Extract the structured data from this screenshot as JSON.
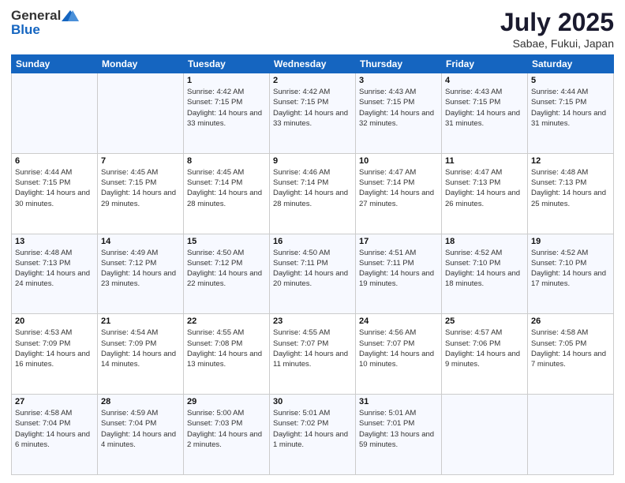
{
  "header": {
    "logo_general": "General",
    "logo_blue": "Blue",
    "month": "July 2025",
    "location": "Sabae, Fukui, Japan"
  },
  "weekdays": [
    "Sunday",
    "Monday",
    "Tuesday",
    "Wednesday",
    "Thursday",
    "Friday",
    "Saturday"
  ],
  "weeks": [
    [
      {
        "day": "",
        "sunrise": "",
        "sunset": "",
        "daylight": ""
      },
      {
        "day": "",
        "sunrise": "",
        "sunset": "",
        "daylight": ""
      },
      {
        "day": "1",
        "sunrise": "Sunrise: 4:42 AM",
        "sunset": "Sunset: 7:15 PM",
        "daylight": "Daylight: 14 hours and 33 minutes."
      },
      {
        "day": "2",
        "sunrise": "Sunrise: 4:42 AM",
        "sunset": "Sunset: 7:15 PM",
        "daylight": "Daylight: 14 hours and 33 minutes."
      },
      {
        "day": "3",
        "sunrise": "Sunrise: 4:43 AM",
        "sunset": "Sunset: 7:15 PM",
        "daylight": "Daylight: 14 hours and 32 minutes."
      },
      {
        "day": "4",
        "sunrise": "Sunrise: 4:43 AM",
        "sunset": "Sunset: 7:15 PM",
        "daylight": "Daylight: 14 hours and 31 minutes."
      },
      {
        "day": "5",
        "sunrise": "Sunrise: 4:44 AM",
        "sunset": "Sunset: 7:15 PM",
        "daylight": "Daylight: 14 hours and 31 minutes."
      }
    ],
    [
      {
        "day": "6",
        "sunrise": "Sunrise: 4:44 AM",
        "sunset": "Sunset: 7:15 PM",
        "daylight": "Daylight: 14 hours and 30 minutes."
      },
      {
        "day": "7",
        "sunrise": "Sunrise: 4:45 AM",
        "sunset": "Sunset: 7:15 PM",
        "daylight": "Daylight: 14 hours and 29 minutes."
      },
      {
        "day": "8",
        "sunrise": "Sunrise: 4:45 AM",
        "sunset": "Sunset: 7:14 PM",
        "daylight": "Daylight: 14 hours and 28 minutes."
      },
      {
        "day": "9",
        "sunrise": "Sunrise: 4:46 AM",
        "sunset": "Sunset: 7:14 PM",
        "daylight": "Daylight: 14 hours and 28 minutes."
      },
      {
        "day": "10",
        "sunrise": "Sunrise: 4:47 AM",
        "sunset": "Sunset: 7:14 PM",
        "daylight": "Daylight: 14 hours and 27 minutes."
      },
      {
        "day": "11",
        "sunrise": "Sunrise: 4:47 AM",
        "sunset": "Sunset: 7:13 PM",
        "daylight": "Daylight: 14 hours and 26 minutes."
      },
      {
        "day": "12",
        "sunrise": "Sunrise: 4:48 AM",
        "sunset": "Sunset: 7:13 PM",
        "daylight": "Daylight: 14 hours and 25 minutes."
      }
    ],
    [
      {
        "day": "13",
        "sunrise": "Sunrise: 4:48 AM",
        "sunset": "Sunset: 7:13 PM",
        "daylight": "Daylight: 14 hours and 24 minutes."
      },
      {
        "day": "14",
        "sunrise": "Sunrise: 4:49 AM",
        "sunset": "Sunset: 7:12 PM",
        "daylight": "Daylight: 14 hours and 23 minutes."
      },
      {
        "day": "15",
        "sunrise": "Sunrise: 4:50 AM",
        "sunset": "Sunset: 7:12 PM",
        "daylight": "Daylight: 14 hours and 22 minutes."
      },
      {
        "day": "16",
        "sunrise": "Sunrise: 4:50 AM",
        "sunset": "Sunset: 7:11 PM",
        "daylight": "Daylight: 14 hours and 20 minutes."
      },
      {
        "day": "17",
        "sunrise": "Sunrise: 4:51 AM",
        "sunset": "Sunset: 7:11 PM",
        "daylight": "Daylight: 14 hours and 19 minutes."
      },
      {
        "day": "18",
        "sunrise": "Sunrise: 4:52 AM",
        "sunset": "Sunset: 7:10 PM",
        "daylight": "Daylight: 14 hours and 18 minutes."
      },
      {
        "day": "19",
        "sunrise": "Sunrise: 4:52 AM",
        "sunset": "Sunset: 7:10 PM",
        "daylight": "Daylight: 14 hours and 17 minutes."
      }
    ],
    [
      {
        "day": "20",
        "sunrise": "Sunrise: 4:53 AM",
        "sunset": "Sunset: 7:09 PM",
        "daylight": "Daylight: 14 hours and 16 minutes."
      },
      {
        "day": "21",
        "sunrise": "Sunrise: 4:54 AM",
        "sunset": "Sunset: 7:09 PM",
        "daylight": "Daylight: 14 hours and 14 minutes."
      },
      {
        "day": "22",
        "sunrise": "Sunrise: 4:55 AM",
        "sunset": "Sunset: 7:08 PM",
        "daylight": "Daylight: 14 hours and 13 minutes."
      },
      {
        "day": "23",
        "sunrise": "Sunrise: 4:55 AM",
        "sunset": "Sunset: 7:07 PM",
        "daylight": "Daylight: 14 hours and 11 minutes."
      },
      {
        "day": "24",
        "sunrise": "Sunrise: 4:56 AM",
        "sunset": "Sunset: 7:07 PM",
        "daylight": "Daylight: 14 hours and 10 minutes."
      },
      {
        "day": "25",
        "sunrise": "Sunrise: 4:57 AM",
        "sunset": "Sunset: 7:06 PM",
        "daylight": "Daylight: 14 hours and 9 minutes."
      },
      {
        "day": "26",
        "sunrise": "Sunrise: 4:58 AM",
        "sunset": "Sunset: 7:05 PM",
        "daylight": "Daylight: 14 hours and 7 minutes."
      }
    ],
    [
      {
        "day": "27",
        "sunrise": "Sunrise: 4:58 AM",
        "sunset": "Sunset: 7:04 PM",
        "daylight": "Daylight: 14 hours and 6 minutes."
      },
      {
        "day": "28",
        "sunrise": "Sunrise: 4:59 AM",
        "sunset": "Sunset: 7:04 PM",
        "daylight": "Daylight: 14 hours and 4 minutes."
      },
      {
        "day": "29",
        "sunrise": "Sunrise: 5:00 AM",
        "sunset": "Sunset: 7:03 PM",
        "daylight": "Daylight: 14 hours and 2 minutes."
      },
      {
        "day": "30",
        "sunrise": "Sunrise: 5:01 AM",
        "sunset": "Sunset: 7:02 PM",
        "daylight": "Daylight: 14 hours and 1 minute."
      },
      {
        "day": "31",
        "sunrise": "Sunrise: 5:01 AM",
        "sunset": "Sunset: 7:01 PM",
        "daylight": "Daylight: 13 hours and 59 minutes."
      },
      {
        "day": "",
        "sunrise": "",
        "sunset": "",
        "daylight": ""
      },
      {
        "day": "",
        "sunrise": "",
        "sunset": "",
        "daylight": ""
      }
    ]
  ]
}
